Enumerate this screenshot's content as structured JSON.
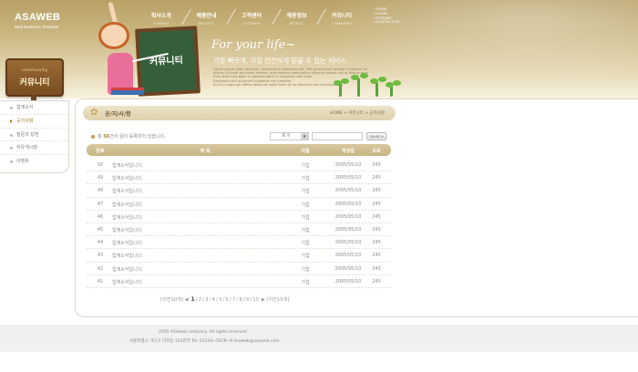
{
  "brand": {
    "name": "ASAWEB",
    "tagline": "Web Business Template"
  },
  "gnb": [
    {
      "ko": "회사소개",
      "en": "COMPANY"
    },
    {
      "ko": "제품안내",
      "en": "PRODUCT"
    },
    {
      "ko": "고객센터",
      "en": "CUSTOMER"
    },
    {
      "ko": "채용정보",
      "en": "RECRUIT"
    },
    {
      "ko": "커뮤니티",
      "en": "COMMUNITY"
    }
  ],
  "util_links": [
    "HOME",
    "LOGIN",
    "SITEMAP",
    "CONTACT US"
  ],
  "hero": {
    "board_text": "커뮤니티",
    "slogan": "For your life~",
    "slogan_sub": "가장 빠르게, 가장 안전하게 믿을 수 있는 서비스",
    "desc_lines": [
      "Lorem ipsum dolor sit amet, consectetur adipiscing elit. Sed do eiusmod tempor incididunt ut labore et dolore magna",
      "aliqua. Ut enim ad minim veniam, quis nostrud exercitation ullamco laboris nisi ut aliquip ex ea commodo",
      "Duis aute irure dolor in reprehenderit in voluptate velit esse",
      "Excepteur sint occaecat cupidatat non proident",
      "Sunt in culpa qui officia deserunt mollit anim id est laborum sed ut perspiciatis"
    ]
  },
  "sidebar": {
    "sign_small": "community",
    "sign_title": "커뮤니티",
    "items": [
      {
        "label": "업계소식",
        "active": false
      },
      {
        "label": "공지사항",
        "active": true
      },
      {
        "label": "질문과 답변",
        "active": false
      },
      {
        "label": "자유게시판",
        "active": false
      },
      {
        "label": "이벤트",
        "active": false
      }
    ]
  },
  "board": {
    "title": "공/지/사/항",
    "breadcrumb": "HOME > 커뮤니티 > 공지사항",
    "total_prefix": "총 ",
    "total_count": "50",
    "total_suffix": "건의 글이 등록되어 있습니다.",
    "search_select": "제 목",
    "search_button": "SEARCH",
    "columns": {
      "no": "번호",
      "title": "제 목",
      "name": "이름",
      "date": "작성일",
      "hits": "조회"
    },
    "rows": [
      {
        "no": "50",
        "title": "업계소식입니다.",
        "name": "기업",
        "date": "2005/05/10",
        "hits": "245"
      },
      {
        "no": "49",
        "title": "업계소식입니다.",
        "name": "기업",
        "date": "2005/05/10",
        "hits": "245"
      },
      {
        "no": "48",
        "title": "업계소식입니다.",
        "name": "기업",
        "date": "2005/05/10",
        "hits": "245"
      },
      {
        "no": "47",
        "title": "업계소식입니다.",
        "name": "기업",
        "date": "2005/05/10",
        "hits": "245"
      },
      {
        "no": "46",
        "title": "업계소식입니다.",
        "name": "기업",
        "date": "2005/05/10",
        "hits": "245"
      },
      {
        "no": "45",
        "title": "업계소식입니다.",
        "name": "기업",
        "date": "2005/05/10",
        "hits": "245"
      },
      {
        "no": "44",
        "title": "업계소식입니다.",
        "name": "기업",
        "date": "2005/05/10",
        "hits": "245"
      },
      {
        "no": "43",
        "title": "업계소식입니다.",
        "name": "기업",
        "date": "2005/05/10",
        "hits": "245"
      },
      {
        "no": "42",
        "title": "업계소식입니다.",
        "name": "기업",
        "date": "2005/05/10",
        "hits": "245"
      },
      {
        "no": "41",
        "title": "업계소식입니다.",
        "name": "기업",
        "date": "2005/05/10",
        "hits": "245"
      }
    ],
    "pager": {
      "prev": "[이전10개]",
      "prev_arrow": "◀",
      "pages": [
        "1",
        "2",
        "3",
        "4",
        "5",
        "6",
        "7",
        "8",
        "9",
        "10"
      ],
      "current": "1",
      "next_arrow": "▶",
      "next": "[이전10개]"
    }
  },
  "footer": {
    "copyright": "2005 ASAweb company.  All rights reserved.",
    "address": "서울특별시 가나구 다라동 123번지 Tel. 01234~5678~9 asaweb@asaweb.com"
  }
}
